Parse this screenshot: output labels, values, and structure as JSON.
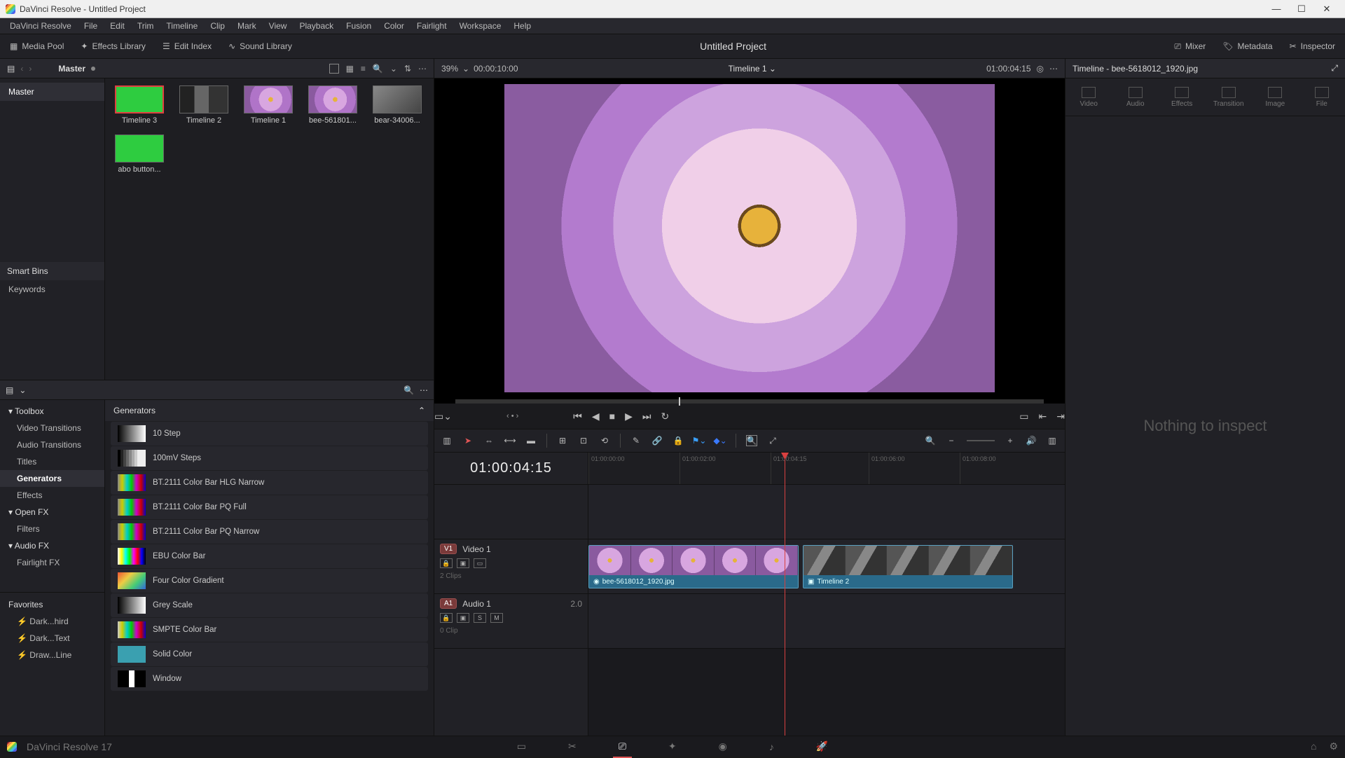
{
  "window": {
    "title": "DaVinci Resolve - Untitled Project"
  },
  "menu": [
    "DaVinci Resolve",
    "File",
    "Edit",
    "Trim",
    "Timeline",
    "Clip",
    "Mark",
    "View",
    "Playback",
    "Fusion",
    "Color",
    "Fairlight",
    "Workspace",
    "Help"
  ],
  "toolbar": {
    "media_pool": "Media Pool",
    "effects_library": "Effects Library",
    "edit_index": "Edit Index",
    "sound_library": "Sound Library",
    "project_title": "Untitled Project",
    "mixer": "Mixer",
    "metadata": "Metadata",
    "inspector": "Inspector"
  },
  "media_pool": {
    "bin_header": "Master",
    "tree": {
      "root": "Master",
      "smart_bins": "Smart Bins",
      "keywords": "Keywords"
    },
    "clips": [
      {
        "label": "Timeline 3",
        "kind": "green",
        "selected": true
      },
      {
        "label": "Timeline 2",
        "kind": "bw"
      },
      {
        "label": "Timeline 1",
        "kind": "flower"
      },
      {
        "label": "bee-561801...",
        "kind": "flower"
      },
      {
        "label": "bear-34006...",
        "kind": "grey"
      },
      {
        "label": "abo button...",
        "kind": "green"
      }
    ]
  },
  "effects": {
    "header": "Generators",
    "toolbox": "Toolbox",
    "categories": [
      "Video Transitions",
      "Audio Transitions",
      "Titles",
      "Generators",
      "Effects"
    ],
    "openfx": "Open FX",
    "openfx_sub": "Filters",
    "audiofx": "Audio FX",
    "audiofx_sub": "Fairlight FX",
    "favorites": "Favorites",
    "fav_items": [
      "Dark...hird",
      "Dark...Text",
      "Draw...Line"
    ],
    "items": [
      {
        "name": "10 Step",
        "sw": "linear-gradient(90deg,#000,#fff)"
      },
      {
        "name": "100mV Steps",
        "sw": "linear-gradient(90deg,#000 0 10%,#222 10% 20%,#444 20% 30%,#666 30% 40%,#888 40% 50%,#aaa 50% 60%,#ccc 60% 70%,#eee 70%)"
      },
      {
        "name": "BT.2111 Color Bar HLG Narrow",
        "sw": "linear-gradient(90deg,#888,#cc0,#0cc,#0c0,#c0c,#c00,#00c)"
      },
      {
        "name": "BT.2111 Color Bar PQ Full",
        "sw": "linear-gradient(90deg,#888,#cc0,#0cc,#0c0,#c0c,#c00,#00c)"
      },
      {
        "name": "BT.2111 Color Bar PQ Narrow",
        "sw": "linear-gradient(90deg,#888,#cc0,#0cc,#0c0,#c0c,#c00,#00c)"
      },
      {
        "name": "EBU Color Bar",
        "sw": "linear-gradient(90deg,#fff,#ff0,#0ff,#0f0,#f0f,#f00,#00f,#000)"
      },
      {
        "name": "Four Color Gradient",
        "sw": "linear-gradient(135deg,#e53,#ec4,#4c7,#36d)"
      },
      {
        "name": "Grey Scale",
        "sw": "linear-gradient(90deg,#000,#fff)"
      },
      {
        "name": "SMPTE Color Bar",
        "sw": "linear-gradient(90deg,#ccc,#cc0,#0cc,#0c0,#c0c,#c00,#00c)"
      },
      {
        "name": "Solid Color",
        "sw": "#3aa0b0"
      },
      {
        "name": "Window",
        "sw": "linear-gradient(90deg,#000 0 40%,#fff 40% 60%,#000 60%)"
      }
    ]
  },
  "viewer": {
    "zoom": "39%",
    "duration": "00:00:10:00",
    "timeline_name": "Timeline 1",
    "timecode": "01:00:04:15"
  },
  "timeline_tools": {
    "big_tc": "01:00:04:15"
  },
  "tracks": {
    "video": {
      "badge": "V1",
      "name": "Video 1",
      "sub": "2 Clips"
    },
    "audio": {
      "badge": "A1",
      "name": "Audio 1",
      "ch": "2.0",
      "sub": "0 Clip",
      "solo": "S",
      "mute": "M"
    },
    "clip1": "bee-5618012_1920.jpg",
    "clip2": "Timeline 2",
    "ticks": [
      "01:00:00:00",
      "01:00:02:00",
      "01:00:04:15",
      "01:00:06:00",
      "01:00:08:00"
    ]
  },
  "inspector": {
    "title": "Timeline - bee-5618012_1920.jpg",
    "tabs": [
      "Video",
      "Audio",
      "Effects",
      "Transition",
      "Image",
      "File"
    ],
    "empty": "Nothing to inspect"
  },
  "pagebar": {
    "app": "DaVinci Resolve 17"
  }
}
